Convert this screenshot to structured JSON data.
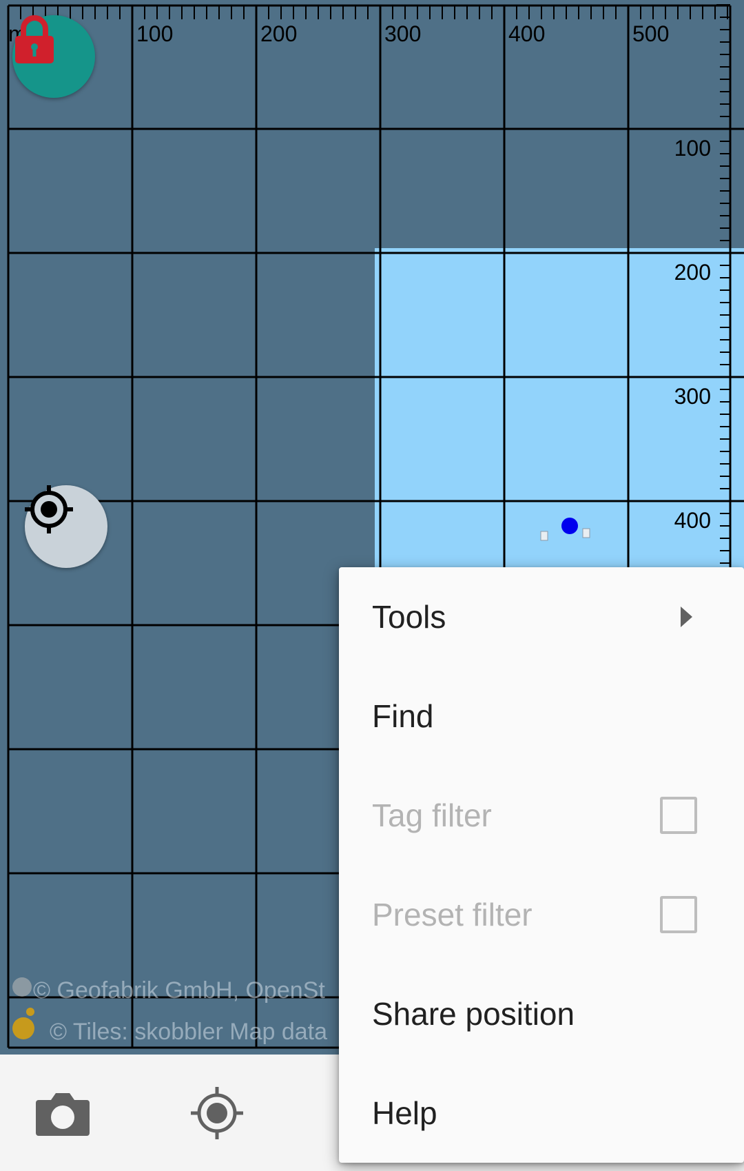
{
  "map": {
    "ruler": {
      "unit": "m",
      "x_labels": [
        "100",
        "200",
        "300",
        "400",
        "500"
      ],
      "y_labels": [
        "100",
        "200",
        "300",
        "400"
      ]
    },
    "attribution": {
      "line1": "© Geofabrik GmbH, OpenSt",
      "line2": "© Tiles: skobbler Map data"
    },
    "colors": {
      "background": "#4f7087",
      "highlight_area": "#92d3fb",
      "grid_line": "#000000",
      "position_marker": "#0000ee"
    }
  },
  "buttons": {
    "lock": {
      "icon": "lock-icon",
      "color": "#15958a"
    },
    "gps": {
      "icon": "gps-crosshair-icon"
    }
  },
  "bottom_bar": {
    "camera_icon": "camera-icon",
    "gps_icon": "gps-icon"
  },
  "menu": {
    "items": [
      {
        "label": "Tools",
        "has_submenu": true,
        "enabled": true
      },
      {
        "label": "Find",
        "enabled": true
      },
      {
        "label": "Tag filter",
        "checkbox": true,
        "checked": false,
        "enabled": false
      },
      {
        "label": "Preset filter",
        "checkbox": true,
        "checked": false,
        "enabled": false
      },
      {
        "label": "Share position",
        "enabled": true
      },
      {
        "label": "Help",
        "enabled": true
      }
    ]
  }
}
